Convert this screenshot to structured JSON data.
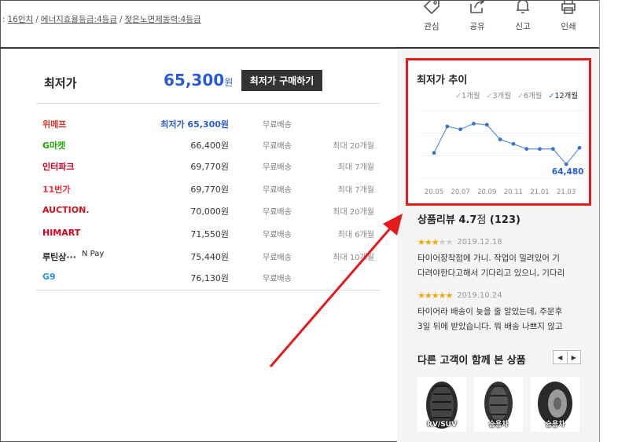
{
  "breadcrumb": {
    "items": [
      "16인치",
      "에너지효율등급:4등급",
      "젖은노면제동력:4등급"
    ],
    "prefix": ":"
  },
  "toolbar": {
    "items": [
      {
        "label": "관심",
        "icon": "tag-icon"
      },
      {
        "label": "공유",
        "icon": "share-icon"
      },
      {
        "label": "신고",
        "icon": "bell-icon"
      },
      {
        "label": "인쇄",
        "icon": "print-icon"
      }
    ]
  },
  "lowest": {
    "label": "최저가",
    "price": "65,300",
    "won": "원",
    "buy_button": "최저가 구매하기"
  },
  "stores": [
    {
      "name": "위메프",
      "price": "최저가 65,300원",
      "shipping": "무료배송",
      "installment": "",
      "best": true,
      "color": "#e0301e"
    },
    {
      "name": "G마켓",
      "price": "66,400원",
      "shipping": "무료배송",
      "installment": "최대 20개월",
      "best": false,
      "color": "#1faa00"
    },
    {
      "name": "인터파크",
      "price": "69,770원",
      "shipping": "무료배송",
      "installment": "최대 7개월",
      "best": false,
      "color": "#d1001f"
    },
    {
      "name": "11번가",
      "price": "69,770원",
      "shipping": "무료배송",
      "installment": "최대 7개월",
      "best": false,
      "color": "#f43142"
    },
    {
      "name": "AUCTION.",
      "price": "70,000원",
      "shipping": "무료배송",
      "installment": "최대 20개월",
      "best": false,
      "color": "#d8101b"
    },
    {
      "name": "HIMART",
      "price": "71,550원",
      "shipping": "무료배송",
      "installment": "최대 6개월",
      "best": false,
      "color": "#d8001a"
    },
    {
      "name": "루틴상···",
      "price": "75,440원",
      "shipping": "무료배송",
      "installment": "최대 10개월",
      "best": false,
      "color": "#222222",
      "npay": "N Pay"
    },
    {
      "name": "G9",
      "price": "76,130원",
      "shipping": "무료배송",
      "installment": "",
      "best": false,
      "color": "#2a8fe0"
    }
  ],
  "chart": {
    "title": "최저가 추이",
    "periods": [
      "1개월",
      "3개월",
      "6개월",
      "12개월"
    ],
    "active_period": "12개월",
    "last_value_label": "64,480",
    "accent": "#5b8fe0",
    "border_color": "#e31b1b"
  },
  "chart_data": {
    "type": "line",
    "title": "최저가 추이",
    "x_ticks": [
      "20.05",
      "20.07",
      "20.09",
      "20.11",
      "21.01",
      "21.03"
    ],
    "x": [
      "20.05",
      "20.06",
      "20.07",
      "20.08",
      "20.09",
      "20.10",
      "20.11",
      "20.12",
      "21.01",
      "21.02",
      "21.03",
      "21.04"
    ],
    "values": [
      66500,
      71200,
      70700,
      71700,
      71500,
      68900,
      68100,
      67200,
      67200,
      67200,
      64480,
      67400
    ],
    "ylim": [
      62000,
      74000
    ],
    "grid": true,
    "annotation": "64,480"
  },
  "reviews": {
    "heading": "상품리뷰",
    "score": "4.7",
    "score_unit": "점",
    "count": "(123)",
    "items": [
      {
        "stars": 3,
        "date": "2019.12.18",
        "line1": "타이어장착점에 가니. 작업이 밀려있어 기",
        "line2": "다려야한다고해서 기다리고 있으니, 기다리"
      },
      {
        "stars": 5,
        "date": "2019.10.24",
        "line1": "타이어라 배송이 늦을 줄 알았는데, 주문후",
        "line2": "3일 뒤에 받았습니다. 뭐 배송 나쁘지 않고"
      }
    ]
  },
  "also_viewed": {
    "heading": "다른 고객이 함께 본 상품",
    "prev": "◀",
    "next": "▶",
    "items": [
      {
        "caption": "RV/SUV"
      },
      {
        "caption": "승용차"
      },
      {
        "caption": "승용차"
      }
    ]
  }
}
